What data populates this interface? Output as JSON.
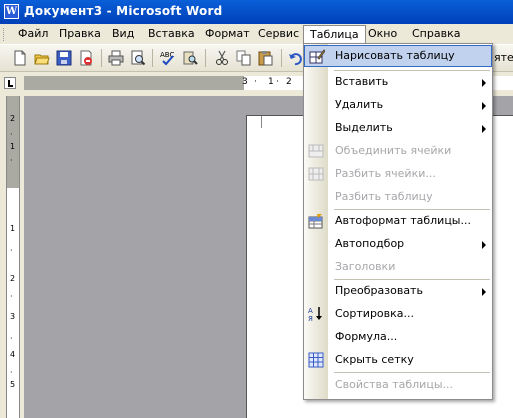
{
  "window": {
    "title": "Документ3 - Microsoft Word",
    "app_icon": "W"
  },
  "menubar": {
    "items": [
      {
        "label": "Файл"
      },
      {
        "label": "Правка"
      },
      {
        "label": "Вид"
      },
      {
        "label": "Вставка"
      },
      {
        "label": "Формат"
      },
      {
        "label": "Сервис"
      },
      {
        "label": "Таблица"
      },
      {
        "label": "Окно"
      },
      {
        "label": "Справка"
      }
    ]
  },
  "toolbar": {
    "partial_text": "ятен",
    "icons": [
      "new-document-icon",
      "open-folder-icon",
      "save-icon",
      "permission-icon",
      "print-icon",
      "print-preview-icon",
      "spelling-icon",
      "research-icon",
      "cut-icon",
      "copy-icon",
      "paste-icon",
      "undo-icon"
    ]
  },
  "ruler": {
    "h_marks": [
      "3",
      "·",
      "1",
      "·",
      "2"
    ],
    "v_marks": [
      "2",
      "·",
      "1",
      "·",
      "1",
      "·",
      "2",
      "·",
      "3",
      "·",
      "4",
      "·",
      "5"
    ]
  },
  "table_menu": {
    "items": [
      {
        "label": "Нарисовать таблицу",
        "enabled": true,
        "icon": "draw-table-icon",
        "submenu": false
      },
      {
        "label": "Вставить",
        "enabled": true,
        "submenu": true
      },
      {
        "label": "Удалить",
        "enabled": true,
        "submenu": true
      },
      {
        "label": "Выделить",
        "enabled": true,
        "submenu": true
      },
      {
        "label": "Объединить ячейки",
        "enabled": false,
        "icon": "merge-cells-icon",
        "submenu": false
      },
      {
        "label": "Разбить ячейки...",
        "enabled": false,
        "icon": "split-cells-icon",
        "submenu": false
      },
      {
        "label": "Разбить таблицу",
        "enabled": false,
        "submenu": false
      },
      {
        "label": "Автоформат таблицы...",
        "enabled": true,
        "icon": "table-autoformat-icon",
        "submenu": false
      },
      {
        "label": "Автоподбор",
        "enabled": true,
        "submenu": true
      },
      {
        "label": "Заголовки",
        "enabled": false,
        "submenu": false
      },
      {
        "label": "Преобразовать",
        "enabled": true,
        "submenu": true
      },
      {
        "label": "Сортировка...",
        "enabled": true,
        "icon": "sort-icon",
        "submenu": false
      },
      {
        "label": "Формула...",
        "enabled": true,
        "submenu": false
      },
      {
        "label": "Скрыть сетку",
        "enabled": true,
        "icon": "hide-gridlines-icon",
        "submenu": false
      },
      {
        "label": "Свойства таблицы...",
        "enabled": false,
        "submenu": false
      }
    ]
  }
}
